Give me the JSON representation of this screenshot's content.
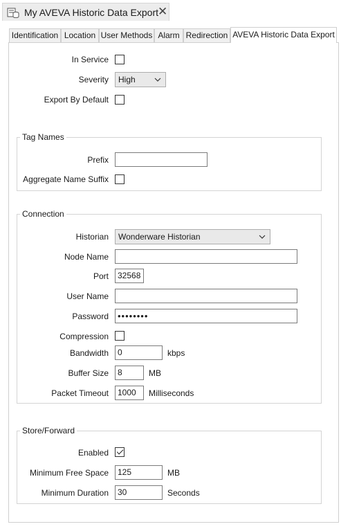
{
  "window": {
    "title": "My AVEVA Historic Data Export"
  },
  "tabs": [
    {
      "label": "Identification"
    },
    {
      "label": "Location"
    },
    {
      "label": "User Methods"
    },
    {
      "label": "Alarm"
    },
    {
      "label": "Redirection"
    },
    {
      "label": "AVEVA Historic Data Export",
      "active": true
    }
  ],
  "general": {
    "in_service_label": "In Service",
    "in_service_checked": false,
    "severity_label": "Severity",
    "severity_value": "High",
    "export_by_default_label": "Export By Default",
    "export_by_default_checked": false
  },
  "tag_names": {
    "title": "Tag Names",
    "prefix_label": "Prefix",
    "prefix_value": "",
    "aggregate_suffix_label": "Aggregate Name Suffix",
    "aggregate_suffix_checked": false
  },
  "connection": {
    "title": "Connection",
    "historian_label": "Historian",
    "historian_value": "Wonderware Historian",
    "node_name_label": "Node Name",
    "node_name_value": "",
    "port_label": "Port",
    "port_value": "32568",
    "user_name_label": "User Name",
    "user_name_value": "",
    "password_label": "Password",
    "password_value": "••••••••",
    "compression_label": "Compression",
    "compression_checked": false,
    "bandwidth_label": "Bandwidth",
    "bandwidth_value": "0",
    "bandwidth_unit": "kbps",
    "buffer_size_label": "Buffer Size",
    "buffer_size_value": "8",
    "buffer_size_unit": "MB",
    "packet_timeout_label": "Packet Timeout",
    "packet_timeout_value": "1000",
    "packet_timeout_unit": "Milliseconds"
  },
  "store_forward": {
    "title": "Store/Forward",
    "enabled_label": "Enabled",
    "enabled_checked": true,
    "min_free_space_label": "Minimum Free Space",
    "min_free_space_value": "125",
    "min_free_space_unit": "MB",
    "min_duration_label": "Minimum Duration",
    "min_duration_value": "30",
    "min_duration_unit": "Seconds"
  },
  "colors": {
    "border": "#cfcfcf",
    "tab_bg": "#f0f0f0",
    "select_bg": "#e9e9e9"
  }
}
